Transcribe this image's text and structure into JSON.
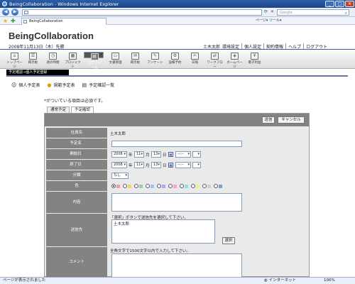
{
  "window": {
    "title": "BeingCollaboration - Windows Internet Explorer"
  },
  "browser": {
    "search_placeholder": "Google",
    "tab_label": "BeingCollaboration",
    "tools_text": "ページ▾  ツール▾"
  },
  "header": {
    "brand": "BeingCollaboration",
    "date": "2008年11月13日（木）先勝",
    "user": "土木太郎",
    "links": [
      "環境設定",
      "個人設定",
      "契約情報",
      "ヘルプ",
      "ログアウト"
    ]
  },
  "nav": {
    "items": [
      "トップページ",
      "掲示板",
      "週の時間",
      "プロジェクト",
      "スケジュール",
      "文書管理",
      "掲示板",
      "アンケート",
      "設備予約",
      "日報",
      "ワークフロー",
      "ホームページ",
      "電子利益"
    ],
    "selected_index": 4
  },
  "page": {
    "section_title": "予定確認→個人予定登録",
    "subnav": [
      "個人予定表",
      "規範予定表",
      "予定確認一覧"
    ],
    "required_notice": "がついている項目は必須です。",
    "required_mark": "*",
    "tabs": [
      "通常予定",
      "予定確認"
    ],
    "active_tab": 1
  },
  "form": {
    "send_label": "送信",
    "cancel_label": "キャンセル",
    "labels": {
      "name": "社員名",
      "title": "予定名",
      "start": "開始日",
      "end": "終了日",
      "category": "分類",
      "color": "色",
      "content": "内容",
      "destination": "送信先",
      "comment": "コメント"
    },
    "required_mark": "*",
    "employee_name": "土木太郎",
    "start": {
      "year": "2008",
      "month": "11",
      "day": "13",
      "time": "--:--"
    },
    "end": {
      "year": "2008",
      "month": "11",
      "day": "13",
      "time": "--:--"
    },
    "unit_year": "年",
    "unit_month": "月",
    "unit_day": "日",
    "category_value": "なし",
    "colors": [
      "#f0a0a0",
      "#ffd060",
      "#a0d0a0",
      "#a0c0ff",
      "#c0a0ff",
      "#ffa0d0",
      "#90e0e0",
      "#f0f090",
      "#d0d0d0",
      "#80a0d0"
    ],
    "color_selected_index": 0,
    "destination_hint": "「選択」ボタンで送信先を選択して下さい。",
    "destination_value": "土木太郎",
    "select_label": "選択",
    "comment_hint": "全角文字で1500文字以内で入力して下さい。"
  },
  "status": {
    "left": "ページが表示されました",
    "zone": "インターネット",
    "zoom": "100%"
  }
}
